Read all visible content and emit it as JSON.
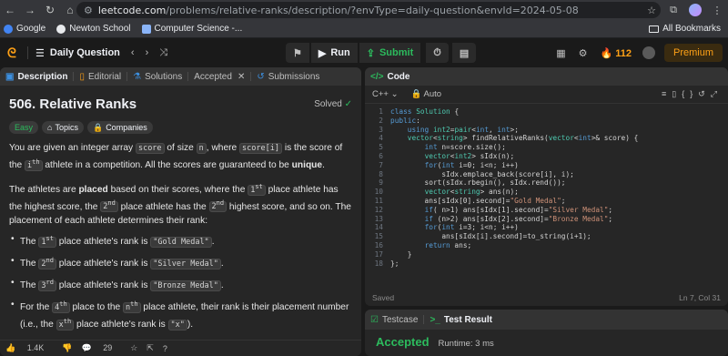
{
  "browser": {
    "url_domain": "leetcode.com",
    "url_path": "/problems/relative-ranks/description/?envType=daily-question&envId=2024-05-08",
    "bookmarks": [
      "Google",
      "Newton School",
      "Computer Science -..."
    ],
    "all_bookmarks": "All Bookmarks"
  },
  "nav": {
    "daily_label": "Daily Question",
    "run_label": "Run",
    "submit_label": "Submit",
    "streak": "112",
    "premium_label": "Premium"
  },
  "left_tabs": [
    "Description",
    "Editorial",
    "Solutions",
    "Accepted",
    "Submissions"
  ],
  "problem": {
    "title": "506. Relative Ranks",
    "status": "Solved",
    "chips": [
      "Easy",
      "Topics",
      "Companies"
    ]
  },
  "footer": {
    "likes": "1.4K",
    "comments": "29"
  },
  "editor": {
    "panel_title": "Code",
    "language": "C++",
    "mode": "Auto",
    "status_left": "Saved",
    "status_right": "Ln 7, Col 31"
  },
  "result": {
    "tabs": [
      "Testcase",
      "Test Result"
    ],
    "verdict": "Accepted",
    "runtime": "Runtime: 3 ms"
  },
  "colors": {
    "accent": "#ffa116",
    "green": "#2cbb5d",
    "bg": "#1a1a1a"
  }
}
